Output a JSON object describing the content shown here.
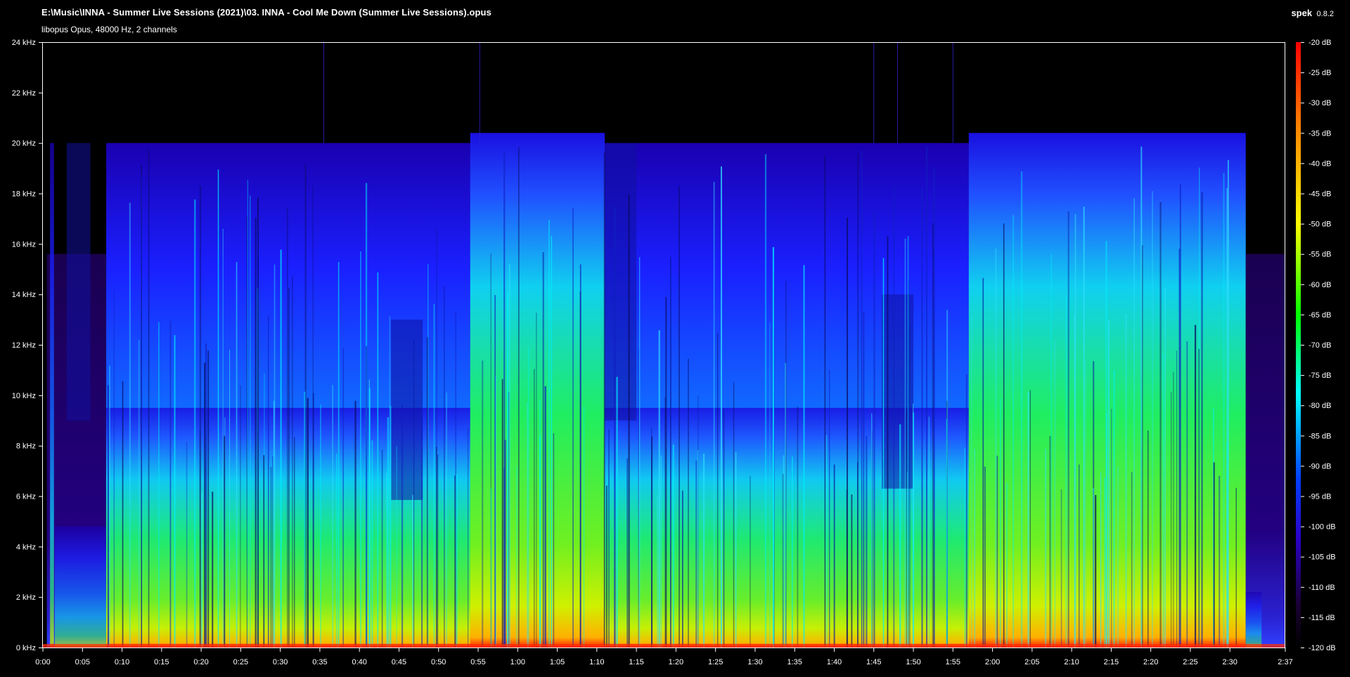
{
  "window": {
    "file_path": "E:\\Music\\INNA - Summer Live Sessions (2021)\\03. INNA - Cool Me Down (Summer Live Sessions).opus",
    "file_info": "libopus Opus, 48000 Hz, 2 channels",
    "app_name": "spek",
    "app_version": "0.8.2"
  },
  "colors": {
    "background": "#000000",
    "axis": "#ffffff",
    "scale_stops": [
      "#ff0000",
      "#ff8c00",
      "#ffff00",
      "#00ff00",
      "#00ffff",
      "#0040ff",
      "#1a00c8",
      "#1a0033",
      "#000000"
    ]
  },
  "spectrogram": {
    "freq_ticks": [
      "0 kHz",
      "2 kHz",
      "4 kHz",
      "6 kHz",
      "8 kHz",
      "10 kHz",
      "12 kHz",
      "14 kHz",
      "16 kHz",
      "18 kHz",
      "20 kHz",
      "22 kHz",
      "24 kHz"
    ],
    "time_ticks": [
      "0:00",
      "0:05",
      "0:10",
      "0:15",
      "0:20",
      "0:25",
      "0:30",
      "0:35",
      "0:40",
      "0:45",
      "0:50",
      "0:55",
      "1:00",
      "1:05",
      "1:10",
      "1:15",
      "1:20",
      "1:25",
      "1:30",
      "1:35",
      "1:40",
      "1:45",
      "1:50",
      "1:55",
      "2:00",
      "2:05",
      "2:10",
      "2:15",
      "2:20",
      "2:25",
      "2:30",
      "2:37"
    ],
    "db_ticks": [
      "-20 dB",
      "-25 dB",
      "-30 dB",
      "-35 dB",
      "-40 dB",
      "-45 dB",
      "-50 dB",
      "-55 dB",
      "-60 dB",
      "-65 dB",
      "-70 dB",
      "-75 dB",
      "-80 dB",
      "-85 dB",
      "-90 dB",
      "-95 dB",
      "-100 dB",
      "-105 dB",
      "-110 dB",
      "-115 dB",
      "-120 dB"
    ],
    "duration_seconds": 157,
    "max_freq_khz": 24,
    "db_range": [
      -120,
      -20
    ]
  }
}
